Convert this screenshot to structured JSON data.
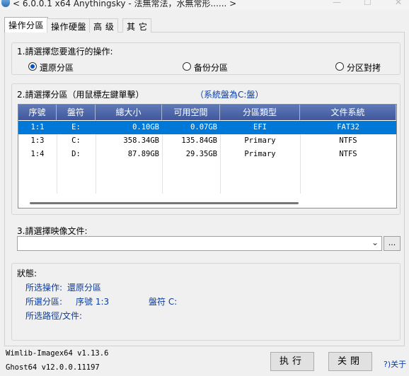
{
  "window": {
    "title": "< 6.0.0.1 x64 Anythingsky - 法無常法，水無常形...... >"
  },
  "tabs": [
    {
      "label": "操作分區",
      "active": true
    },
    {
      "label": "操作硬盤",
      "active": false
    },
    {
      "label": "高 级",
      "active": false
    },
    {
      "label": "其 它",
      "active": false
    }
  ],
  "section1": {
    "label": "1.請選擇您要進行的操作:",
    "options": [
      {
        "label": "還原分區",
        "checked": true
      },
      {
        "label": "备份分區",
        "checked": false
      },
      {
        "label": "分区對拷",
        "checked": false
      }
    ]
  },
  "section2": {
    "label": "2.請選擇分區（用鼠標左鍵單擊）",
    "hint": "（系統盤為C:盤）",
    "columns": [
      "序號",
      "盤符",
      "總大小",
      "可用空間",
      "分區類型",
      "文件系統"
    ],
    "rows": [
      {
        "cells": [
          "1:1",
          "E:",
          "0.10GB",
          "0.07GB",
          "EFI",
          "FAT32"
        ],
        "selected": true
      },
      {
        "cells": [
          "1:3",
          "C:",
          "358.34GB",
          "135.84GB",
          "Primary",
          "NTFS"
        ],
        "selected": false
      },
      {
        "cells": [
          "1:4",
          "D:",
          "87.89GB",
          "29.35GB",
          "Primary",
          "NTFS"
        ],
        "selected": false
      }
    ]
  },
  "section3": {
    "label": "3.請選擇映像文件:",
    "value": "",
    "browse_label": "..."
  },
  "status": {
    "label": "狀態:",
    "operation_label": "所选操作:",
    "operation_value": "還原分區",
    "partition_label": "所選分區:",
    "partition_index": "序號 1:3",
    "partition_drive": "盤符 C:",
    "path_label": "所选路徑/文件:"
  },
  "footer": {
    "wimlib": "Wimlib-Imagex64 v1.13.6",
    "ghost": "Ghost64 v12.0.0.11197",
    "execute_label": "执行",
    "close_label": "关閉",
    "about_label": "?)关于"
  }
}
